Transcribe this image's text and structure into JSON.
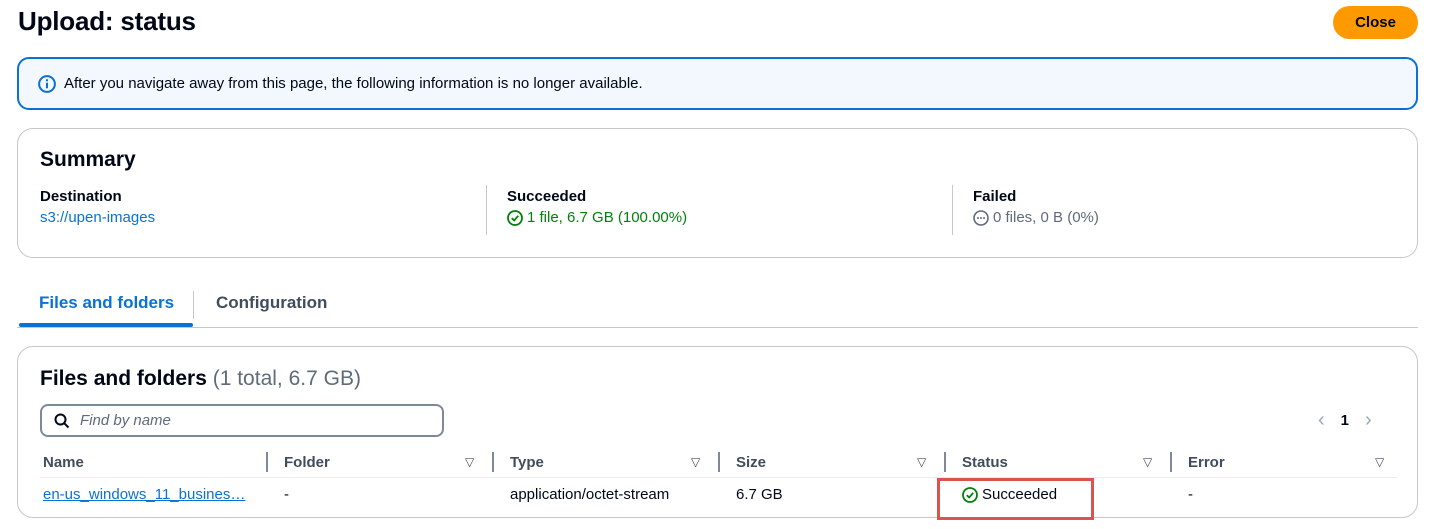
{
  "header": {
    "title": "Upload: status",
    "close_label": "Close"
  },
  "alert": {
    "message": "After you navigate away from this page, the following information is no longer available."
  },
  "summary": {
    "title": "Summary",
    "destination": {
      "label": "Destination",
      "value": "s3://upen-images"
    },
    "succeeded": {
      "label": "Succeeded",
      "value": "1 file, 6.7 GB (100.00%)"
    },
    "failed": {
      "label": "Failed",
      "value": "0 files, 0 B (0%)"
    }
  },
  "tabs": [
    {
      "label": "Files and folders",
      "active": true
    },
    {
      "label": "Configuration",
      "active": false
    }
  ],
  "files": {
    "title": "Files and folders",
    "count": "(1 total, 6.7 GB)",
    "search_placeholder": "Find by name",
    "page": "1",
    "columns": [
      "Name",
      "Folder",
      "Type",
      "Size",
      "Status",
      "Error"
    ],
    "rows": [
      {
        "name": "en-us_windows_11_busines…",
        "folder": "-",
        "type": "application/octet-stream",
        "size": "6.7 GB",
        "status": "Succeeded",
        "error": "-"
      }
    ]
  },
  "colors": {
    "accent": "#0972d3",
    "success": "#037f0c",
    "primary_button": "#ff9900",
    "highlight": "#d9534f"
  }
}
